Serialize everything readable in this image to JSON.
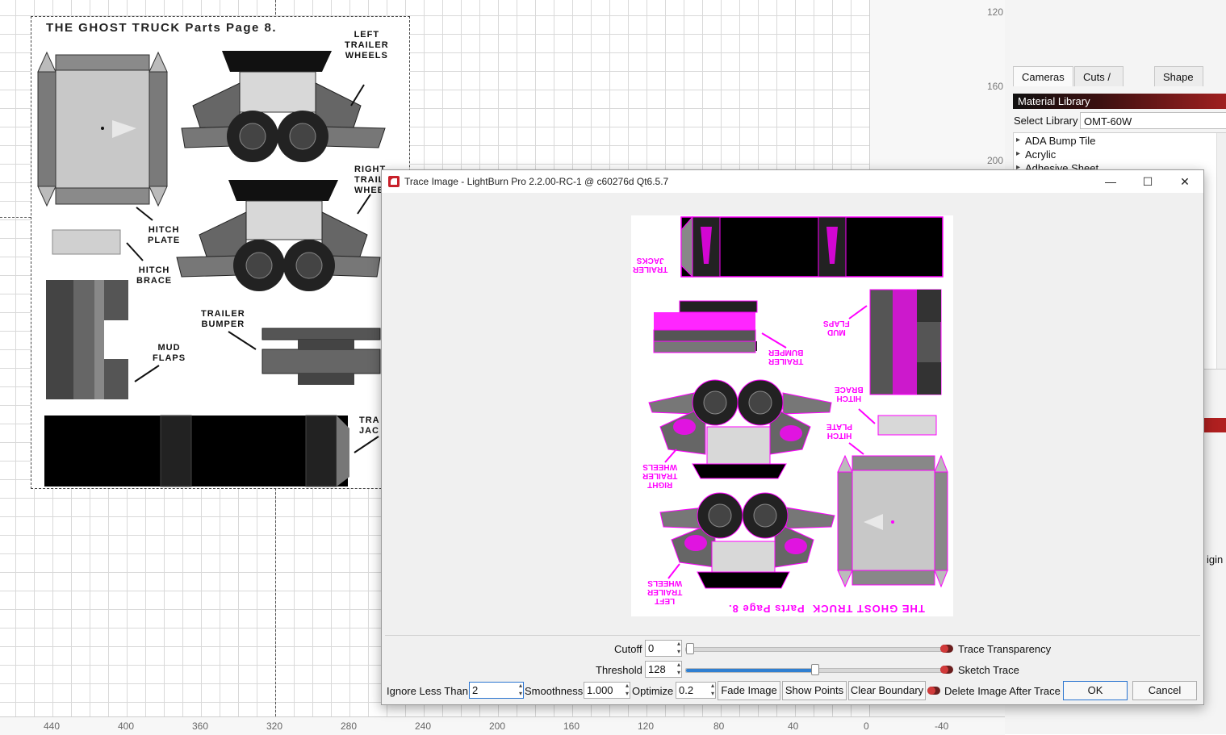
{
  "workspace": {
    "part_page": {
      "title": "THE GHOST TRUCK  Parts Page 8.",
      "labels": {
        "left_trailer_wheels": "LEFT\nTRAILER\nWHEELS",
        "right_trailer_wheels": "RIGHT\nTRAIL\nWHEE",
        "hitch_plate": "HITCH\nPLATE",
        "hitch_brace": "HITCH\nBRACE",
        "trailer_bumper": "TRAILER\nBUMPER",
        "mud_flaps": "MUD\nFLAPS",
        "trailer_jacks": "TRA\nJAC"
      }
    },
    "ruler_bottom": [
      "440",
      "400",
      "360",
      "320",
      "280",
      "240",
      "200",
      "160",
      "120",
      "80",
      "40",
      "0",
      "-40"
    ],
    "ruler_right": [
      "120",
      "160",
      "200"
    ]
  },
  "right_panel": {
    "tabs": [
      "Cameras",
      "Cuts / Layers",
      "Shape Proper"
    ],
    "material_library": {
      "header": "Material Library",
      "select_label": "Select Library",
      "selected": "OMT-60W",
      "items": [
        "ADA Bump Tile",
        "Acrylic",
        "Adhesive Sheet"
      ]
    },
    "partial_text": "igin"
  },
  "dialog": {
    "title": "Trace Image - LightBurn Pro 2.2.00-RC-1 @ c60276d Qt6.5.7",
    "minimize": "—",
    "maximize": "☐",
    "close": "✕",
    "preview_labels": {
      "title": "THE GHOST TRUCK  Parts Page 8.",
      "trailer_jacks": "TRAILER\nJACKS",
      "trailer_bumper": "TRAILER\nBUMPER",
      "mud_flaps": "MUD\nFLAPS",
      "hitch_brace": "HITCH\nBRACE",
      "hitch_plate": "HITCH\nPLATE",
      "right_trailer_wheels": "RIGHT\nTRAILER\nWHEELS",
      "left_trailer_wheels": "LEFT\nTRAILER\nWHEELS"
    },
    "cutoff": {
      "label": "Cutoff",
      "value": "0",
      "level": 0
    },
    "threshold": {
      "label": "Threshold",
      "value": "128",
      "level": 0.5
    },
    "trace_transparency": {
      "label": "Trace Transparency"
    },
    "sketch_trace": {
      "label": "Sketch Trace"
    },
    "ignore_less_than": {
      "label": "Ignore Less Than",
      "value": "2"
    },
    "smoothness": {
      "label": "Smoothness",
      "value": "1.000"
    },
    "optimize": {
      "label": "Optimize",
      "value": "0.2"
    },
    "fade_image": "Fade Image",
    "show_points": "Show Points",
    "clear_boundary": "Clear Boundary",
    "delete_image_after_trace": {
      "label": "Delete Image After Trace"
    },
    "ok": "OK",
    "cancel": "Cancel"
  }
}
